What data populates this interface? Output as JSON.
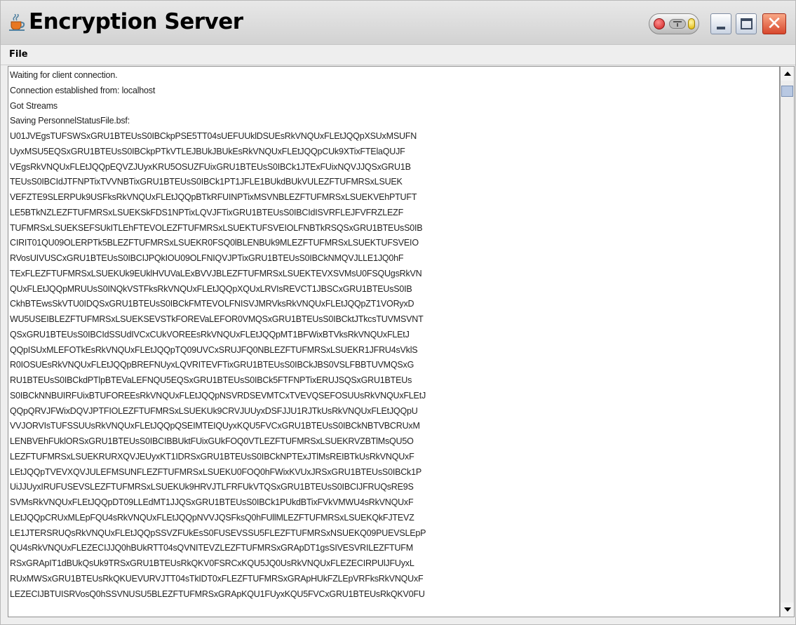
{
  "window": {
    "title": "Encryption Server",
    "icon": "java-cup-icon",
    "controls": [
      "options-pill-icon",
      "minimize-icon",
      "maximize-icon",
      "close-icon"
    ]
  },
  "menu": {
    "file_label": "File"
  },
  "log_lines": [
    "Waiting for client connection.",
    "Connection established from: localhost",
    "Got Streams",
    "Saving PersonnelStatusFile.bsf:",
    "U01JVEgsTUFSWSxGRU1BTEUsS0IBCkpPSE5TT04sUEFUUklDSUEsRkVNQUxFLEtJQQpXSUxMSUFN",
    "UyxMSU5EQSxGRU1BTEUsS0IBCkpPTkVTLEJBUkJBUkEsRkVNQUxFLEtJQQpCUk9XTixFTElaQUJF",
    "VEgsRkVNQUxFLEtJQQpEQVZJUyxKRU5OSUZFUixGRU1BTEUsS0IBCk1JTExFUixNQVJJQSxGRU1B",
    "TEUsS0IBCIdJTFNPTixTVVNBTixGRU1BTEUsS0IBCk1PT1JFLE1BUkdBUkVULEZFTUFMRSxLSUEK",
    "VEFZTE9SLERPUk9USFksRkVNQUxFLEtJQQpBTkRFUINPTixMSVNBLEZFTUFMRSxLSUEKVEhPTUFT",
    "LE5BTkNZLEZFTUFMRSxLSUEKSkFDS1NPTixLQVJFTixGRU1BTEUsS0IBCIdISVRFLEJFVFRZLEZF",
    "TUFMRSxLSUEKSEFSUkITLEhFTEVOLEZFTUFMRSxLSUEKTUFSVEIOLFNBTkRSQSxGRU1BTEUsS0IB",
    "CIRIT01QU09OLERPTk5BLEZFTUFMRSxLSUEKR0FSQ0lBLENBUk9MLEZFTUFMRSxLSUEKTUFSVEIO",
    "RVosUIVUSCxGRU1BTEUsS0IBCIJPQkIOU09OLFNIQVJPTixGRU1BTEUsS0IBCkNMQVJLLE1JQ0hF",
    "TExFLEZFTUFMRSxLSUEKUk9EUklHVUVaLExBVVJBLEZFTUFMRSxLSUEKTEVXSVMsU0FSQUgsRkVN",
    "QUxFLEtJQQpMRUUsS0INQkVSTFksRkVNQUxFLEtJQQpXQUxLRVIsREVCT1JBSCxGRU1BTEUsS0IB",
    "CkhBTEwsSkVTU0IDQSxGRU1BTEUsS0IBCkFMTEVOLFNISVJMRVksRkVNQUxFLEtJQQpZT1VORyxD",
    "WU5USEIBLEZFTUFMRSxLSUEKSEVSTkFOREVaLEFOR0VMQSxGRU1BTEUsS0IBCktJTkcsTUVMSVNT",
    "QSxGRU1BTEUsS0IBCIdSSUdIVCxCUkVOREEsRkVNQUxFLEtJQQpMT1BFWixBTVksRkVNQUxFLEtJ",
    "QQpISUxMLEFOTkEsRkVNQUxFLEtJQQpTQ09UVCxSRUJFQ0NBLEZFTUFMRSxLSUEKR1JFRU4sVklS",
    "R0IOSUEsRkVNQUxFLEtJQQpBREFNUyxLQVRITEVFTixGRU1BTEUsS0IBCkJBS0VSLFBBTUVMQSxG",
    "RU1BTEUsS0IBCkdPTlpBTEVaLEFNQU5EQSxGRU1BTEUsS0IBCk5FTFNPTixERUJSQSxGRU1BTEUs",
    "S0IBCkNNBUIRFUixBTUFOREEsRkVNQUxFLEtJQQpNSVRDSEVMTCxTVEVQSEFOSUUsRkVNQUxFLEtJ",
    "QQpQRVJFWixDQVJPTFIOLEZFTUFMRSxLSUEKUk9CRVJUUyxDSFJJU1RJTkUsRkVNQUxFLEtJQQpU",
    "VVJORVIsTUFSSUUsRkVNQUxFLEtJQQpQSEIMTEIQUyxKQU5FVCxGRU1BTEUsS0IBCkNBTVBCRUxM",
    "LENBVEhFUklORSxGRU1BTEUsS0IBCIBBUktFUixGUkFOQ0VTLEZFTUFMRSxLSUEKRVZBTlMsQU5O",
    "LEZFTUFMRSxLSUEKRURXQVJEUyxKT1IDRSxGRU1BTEUsS0IBCkNPTExJTlMsREIBTkUsRkVNQUxF",
    "LEtJQQpTVEVXQVJULEFMSUNFLEZFTUFMRSxLSUEKU0FOQ0hFWixKVUxJRSxGRU1BTEUsS0IBCk1P",
    "UiJJUyxIRUFUSEVSLEZFTUFMRSxLSUEKUk9HRVJTLFRFUkVTQSxGRU1BTEUsS0IBCIJFRUQsRE9S",
    "SVMsRkVNQUxFLEtJQQpDT09LLEdMT1JJQSxGRU1BTEUsS0IBCk1PUkdBTixFVkVMWU4sRkVNQUxF",
    "LEtJQQpCRUxMLEpFQU4sRkVNQUxFLEtJQQpNVVJQSFksQ0hFUllMLEZFTUFMRSxLSUEKQkFJTEVZ",
    "LE1JTERSRUQsRkVNQUxFLEtJQQpSSVZFUkEsS0FUSEVSSU5FLEZFTUFMRSxNSUEKQ09PUEVSLEpP",
    "QU4sRkVNQUxFLEZECIJJQ0hBUkRTT04sQVNITEVZLEZFTUFMRSxGRApDT1gsSIVESVRILEZFTUFM",
    "RSxGRApIT1dBUkQsUk9TRSxGRU1BTEUsRkQKV0FSRCxKQU5JQ0UsRkVNQUxFLEZECIRPUlJFUyxL",
    "RUxMWSxGRU1BTEUsRkQKUEVURVJTT04sTkIDT0xFLEZFTUFMRSxGRApHUkFZLEpVRFksRkVNQUxF",
    "LEZECIJBTUISRVosQ0hSSVNUSU5BLEZFTUFMRSxGRApKQU1FUyxKQU5FVCxGRU1BTEUsRkQKV0FU"
  ]
}
